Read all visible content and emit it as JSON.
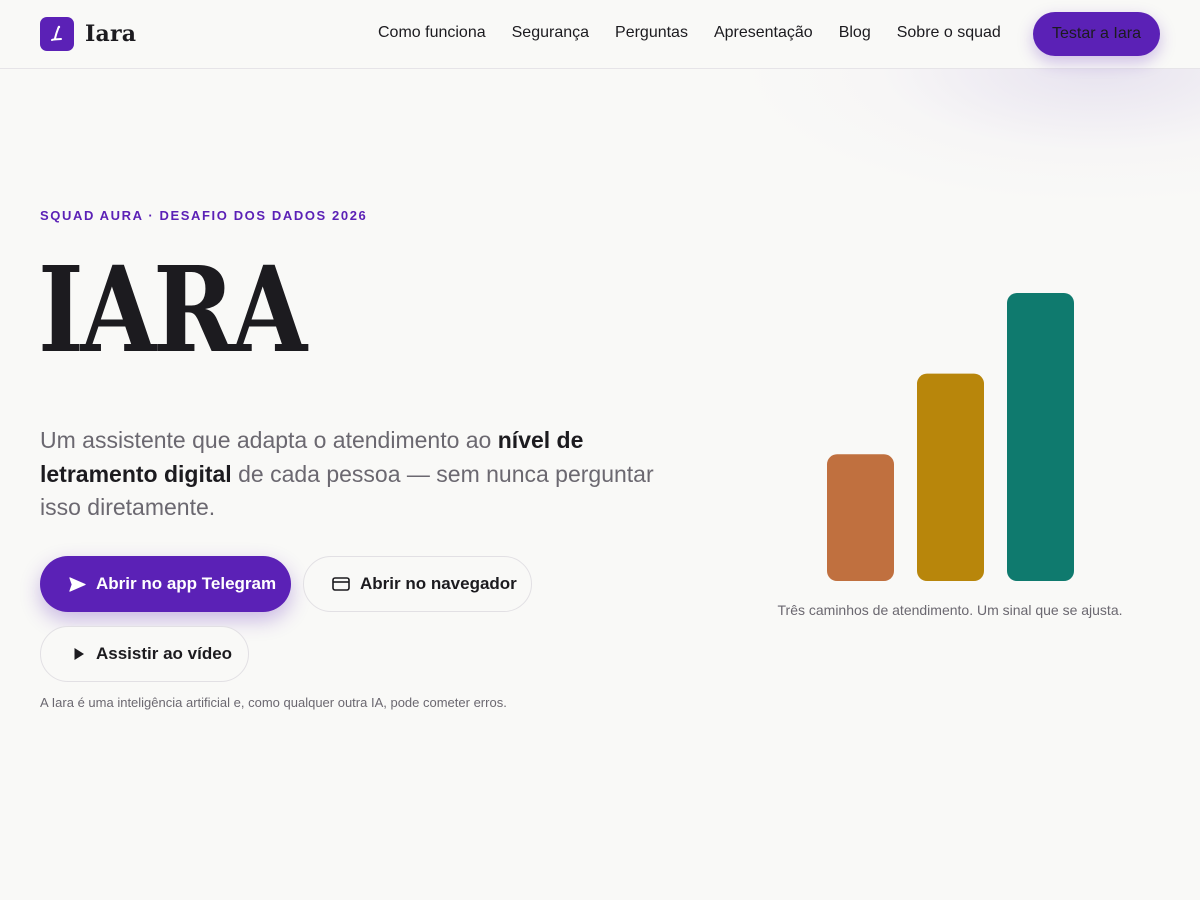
{
  "brand": {
    "name": "Iara",
    "logo_icon": "iara-logo-icon",
    "accent_color": "#5b21b6"
  },
  "nav": {
    "items": [
      {
        "label": "Como funciona"
      },
      {
        "label": "Segurança"
      },
      {
        "label": "Perguntas"
      },
      {
        "label": "Apresentação"
      },
      {
        "label": "Blog"
      },
      {
        "label": "Sobre o squad"
      }
    ],
    "cta_label": "Testar a Iara"
  },
  "hero": {
    "eyebrow": "SQUAD AURA · DESAFIO DOS DADOS 2026",
    "title": "IARA",
    "lead_start": "Um assistente que adapta o atendimento ao ",
    "lead_bold": "nível de letramento digital",
    "lead_end": " de cada pessoa — sem nunca perguntar isso diretamente.",
    "buttons": {
      "telegram_label": "Abrir no app Telegram",
      "telegram_icon": "send-icon",
      "browser_label": "Abrir no navegador",
      "browser_icon": "browser-window-icon",
      "video_label": "Assistir ao vídeo",
      "video_icon": "play-icon"
    },
    "disclaimer": "A Iara é uma inteligência artificial e, como qualquer outra IA, pode cometer erros."
  },
  "illustration": {
    "bars": [
      {
        "level": 0.44,
        "color": "#c0703f"
      },
      {
        "level": 0.72,
        "color": "#b8860b"
      },
      {
        "level": 1.0,
        "color": "#0f7a6e"
      }
    ],
    "caption": "Três caminhos de atendimento. Um sinal que se ajusta."
  }
}
